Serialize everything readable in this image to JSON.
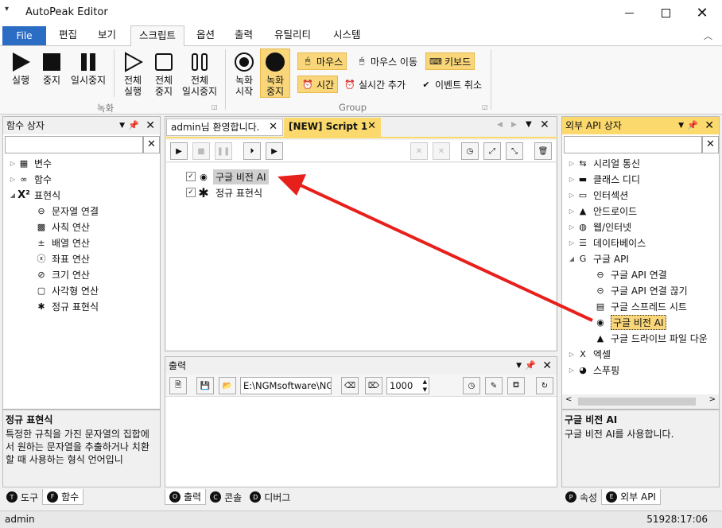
{
  "window": {
    "title": "AutoPeak Editor",
    "qa_icon": "quick-access-arrow-icon"
  },
  "menu": {
    "file": "File",
    "items": [
      "편집",
      "보기",
      "스크립트",
      "옵션",
      "출력",
      "유틸리티",
      "시스템"
    ],
    "active": "스크립트"
  },
  "ribbon": {
    "buttons": {
      "run": "실행",
      "stop": "중지",
      "pause": "일시중지",
      "run_all": "전체\n실행",
      "stop_all": "전체\n중지",
      "pause_all": "전체\n일시중지",
      "rec_start": "녹화\n시작",
      "rec_stop": "녹화\n중지"
    },
    "group1": "녹화",
    "group2": "Group",
    "rec_opts": {
      "mouse": "마우스",
      "mouse_move": "마우스 이동",
      "keyboard": "키보드",
      "time": "시간",
      "realtime": "실시간 추가",
      "cancel_event": "이벤트 취소"
    }
  },
  "left_panel": {
    "title": "함수 상자",
    "items": [
      {
        "label": "변수",
        "icon": "variable-icon",
        "level": 0,
        "expanded": false
      },
      {
        "label": "함수",
        "icon": "function-icon",
        "level": 0,
        "expanded": false
      },
      {
        "label": "표현식",
        "icon": "x-squared-icon",
        "level": 0,
        "expanded": true
      },
      {
        "label": "문자열 연결",
        "icon": "link-icon",
        "level": 1
      },
      {
        "label": "사칙 연산",
        "icon": "calculator-icon",
        "level": 1
      },
      {
        "label": "배열 연산",
        "icon": "plus-minus-icon",
        "level": 1
      },
      {
        "label": "좌표 연산",
        "icon": "xy-icon",
        "level": 1
      },
      {
        "label": "크기 연산",
        "icon": "resize-icon",
        "level": 1
      },
      {
        "label": "사각형 연산",
        "icon": "rectangle-icon",
        "level": 1
      },
      {
        "label": "정규 표현식",
        "icon": "asterisk-icon",
        "level": 1
      }
    ],
    "desc_title": "정규 표현식",
    "desc_text": "특정한 규칙을 가진 문자열의 집합에서 원하는 문자열을 추출하거나 치환할 때 사용하는 형식 언어입니",
    "tabs": [
      {
        "label": "도구",
        "badge": "T"
      },
      {
        "label": "함수",
        "badge": "F"
      }
    ]
  },
  "editor": {
    "tabs": [
      "admin님 환영합니다.",
      "[NEW] Script 1"
    ],
    "lines": [
      {
        "label": "구글 비전 AI",
        "icon": "eye-icon",
        "selected": true
      },
      {
        "label": "정규 표현식",
        "icon": "asterisk-icon",
        "selected": false
      }
    ]
  },
  "output": {
    "title": "출력",
    "path": "E:\\NGMsoftware\\NG",
    "number": "1000",
    "tabs": [
      {
        "label": "출력",
        "badge": "O"
      },
      {
        "label": "콘솔",
        "badge": "C"
      },
      {
        "label": "디버그",
        "badge": "D"
      }
    ]
  },
  "right_panel": {
    "title": "외부 API 상자",
    "items": [
      {
        "label": "시리얼 통신",
        "icon": "serial-icon",
        "level": 0,
        "expanded": false
      },
      {
        "label": "클래스 디디",
        "icon": "class-icon",
        "level": 0,
        "expanded": false
      },
      {
        "label": "인터섹션",
        "icon": "monitor-icon",
        "level": 0,
        "expanded": false
      },
      {
        "label": "안드로이드",
        "icon": "android-icon",
        "level": 0,
        "expanded": false
      },
      {
        "label": "웹/인터넷",
        "icon": "globe-icon",
        "level": 0,
        "expanded": false
      },
      {
        "label": "데이타베이스",
        "icon": "database-icon",
        "level": 0,
        "expanded": false
      },
      {
        "label": "구글 API",
        "icon": "google-icon",
        "level": 0,
        "expanded": true
      },
      {
        "label": "구글 API 연결",
        "icon": "link-icon",
        "level": 1
      },
      {
        "label": "구글 API 연결 끊기",
        "icon": "unlink-icon",
        "level": 1
      },
      {
        "label": "구글 스프레드 시트",
        "icon": "sheet-icon",
        "level": 1
      },
      {
        "label": "구글 비전 AI",
        "icon": "eye-icon",
        "level": 1,
        "selected": true
      },
      {
        "label": "구글 드라이브 파일 다운",
        "icon": "drive-icon",
        "level": 1
      },
      {
        "label": "엑셀",
        "icon": "excel-icon",
        "level": 0,
        "expanded": false
      },
      {
        "label": "스푸핑",
        "icon": "mask-icon",
        "level": 0,
        "expanded": false
      }
    ],
    "desc_title": "구글 비전 AI",
    "desc_text": "구글 비전 AI를 사용합니다.",
    "tabs": [
      {
        "label": "속성",
        "badge": "P"
      },
      {
        "label": "외부 API",
        "badge": "E"
      }
    ]
  },
  "status": {
    "user": "admin",
    "time": "51928:17:06"
  },
  "colors": {
    "accent": "#2b6cc4",
    "highlight": "#fbd96c",
    "arrow": "#e8201c"
  }
}
